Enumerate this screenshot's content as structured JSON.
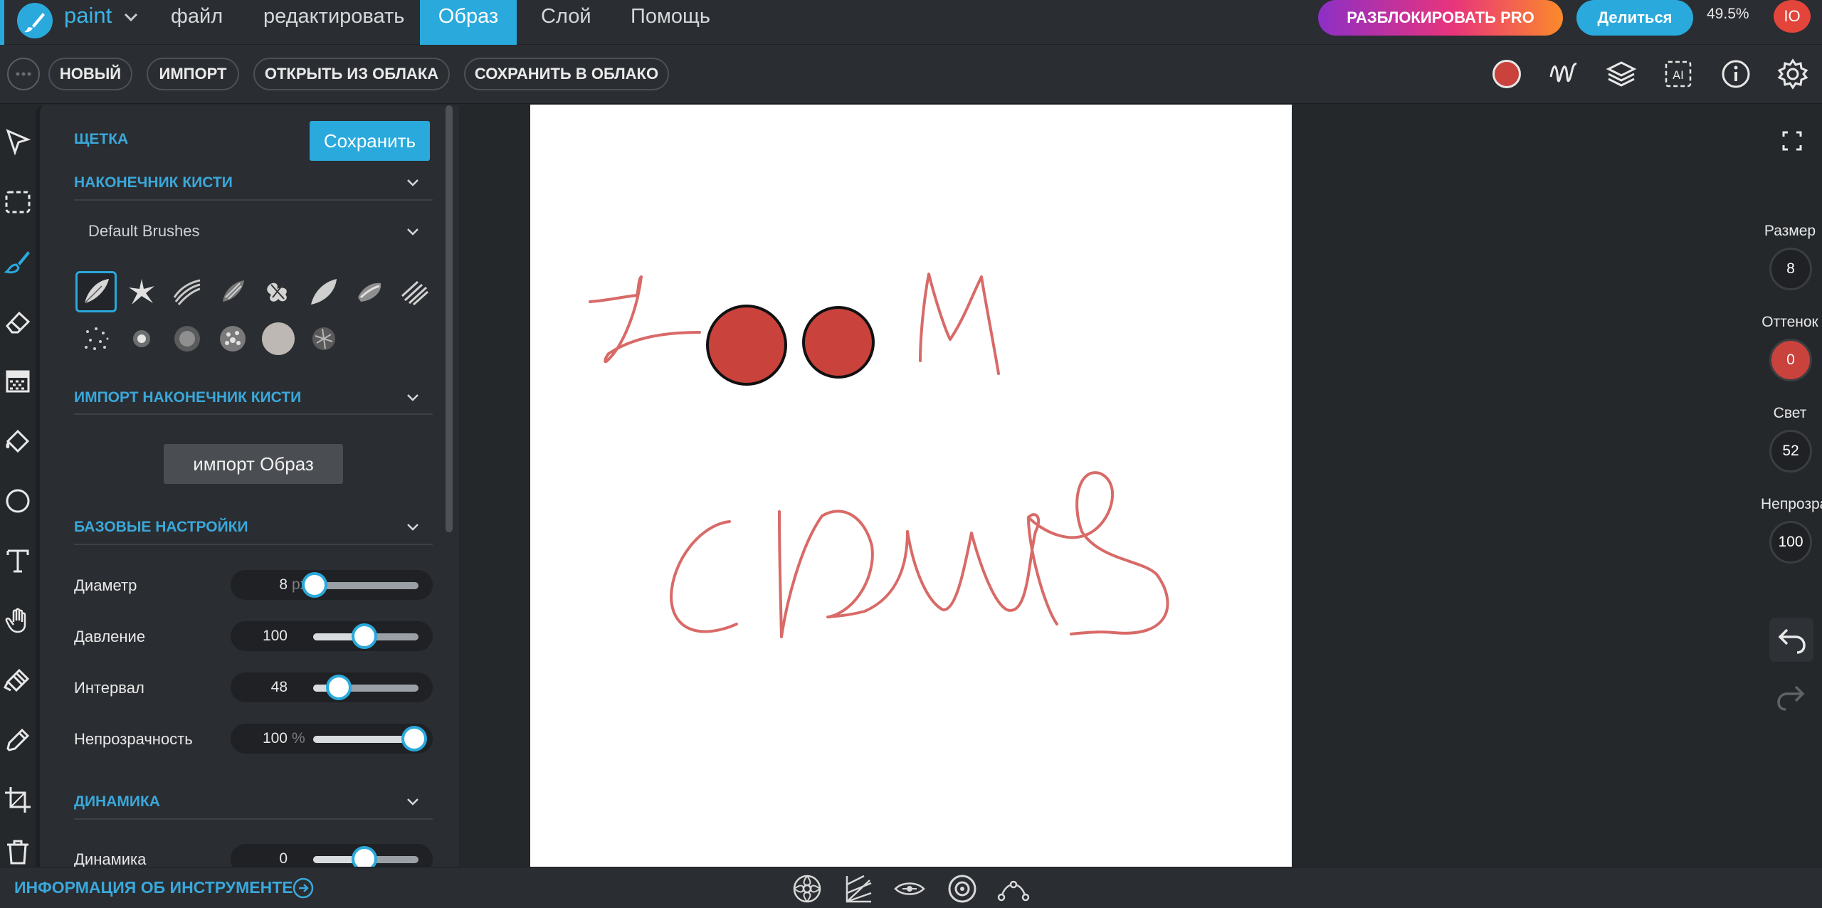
{
  "app": {
    "name": "paint",
    "zoom": "49.5%",
    "user_initials": "IO"
  },
  "menu": [
    "файл",
    "редактировать",
    "Образ",
    "Слой",
    "Помощь"
  ],
  "menu_active": "Образ",
  "header_buttons": {
    "unlock_pro": "РАЗБЛОКИРОВАТЬ PRO",
    "share": "Делиться"
  },
  "toolbar": {
    "new": "НОВЫЙ",
    "import": "ИМПОРТ",
    "open_cloud": "ОТКРЫТЬ ИЗ ОБЛАКА",
    "save_cloud": "СОХРАНИТЬ В ОБЛАКО"
  },
  "panel": {
    "title": "ЩЕТКА",
    "save": "Сохранить",
    "brush_tip_section": "НАКОНЕЧНИК КИСТИ",
    "brush_set": "Default Brushes",
    "import_tip_section": "ИМПОРТ НАКОНЕЧНИК КИСТИ",
    "import_image": "импорт Образ",
    "basic_section": "БАЗОВЫЕ НАСТРОЙКИ",
    "dynamics_section": "ДИНАМИКА"
  },
  "settings": [
    {
      "label": "Диаметр",
      "value": "8",
      "unit": "px",
      "level": 0.0
    },
    {
      "label": "Давление",
      "value": "100",
      "unit": "",
      "level": 0.48
    },
    {
      "label": "Интервал",
      "value": "48",
      "unit": "",
      "level": 0.23
    },
    {
      "label": "Непрозрачность",
      "value": "100",
      "unit": "%",
      "level": 1.0
    },
    {
      "label": "Динамика",
      "value": "0",
      "unit": "",
      "level": 0.48
    }
  ],
  "right_controls": [
    {
      "label": "Размер",
      "value": "8"
    },
    {
      "label": "Оттенок",
      "value": "0"
    },
    {
      "label": "Свет",
      "value": "52"
    },
    {
      "label": "Непрозрачность",
      "value": "100"
    }
  ],
  "bottom": {
    "tool_info": "ИНФОРМАЦИЯ ОБ ИНСТРУМЕНТЕ"
  },
  "colors": {
    "accent": "#2aa9dc",
    "brush_color": "#c9423c",
    "pro_gradient": [
      "#8d2fc6",
      "#e8347c",
      "#fb8a2a"
    ]
  },
  "icons": {
    "tools": [
      "select-arrow-icon",
      "marquee-select-icon",
      "brush-icon",
      "eraser-icon",
      "pattern-fill-icon",
      "paint-bucket-icon",
      "ellipse-shape-icon",
      "text-icon",
      "hand-pan-icon",
      "clone-stamp-icon",
      "eyedropper-icon",
      "crop-icon",
      "trash-icon"
    ],
    "toolbar_right": [
      "color-swatch-icon",
      "wave-icon",
      "layers-icon",
      "ai-icon",
      "info-icon",
      "gear-icon"
    ],
    "bottom": [
      "mandala-icon",
      "perspective-icon",
      "eye-symmetry-icon",
      "radial-icon",
      "curve-nodes-icon"
    ]
  }
}
